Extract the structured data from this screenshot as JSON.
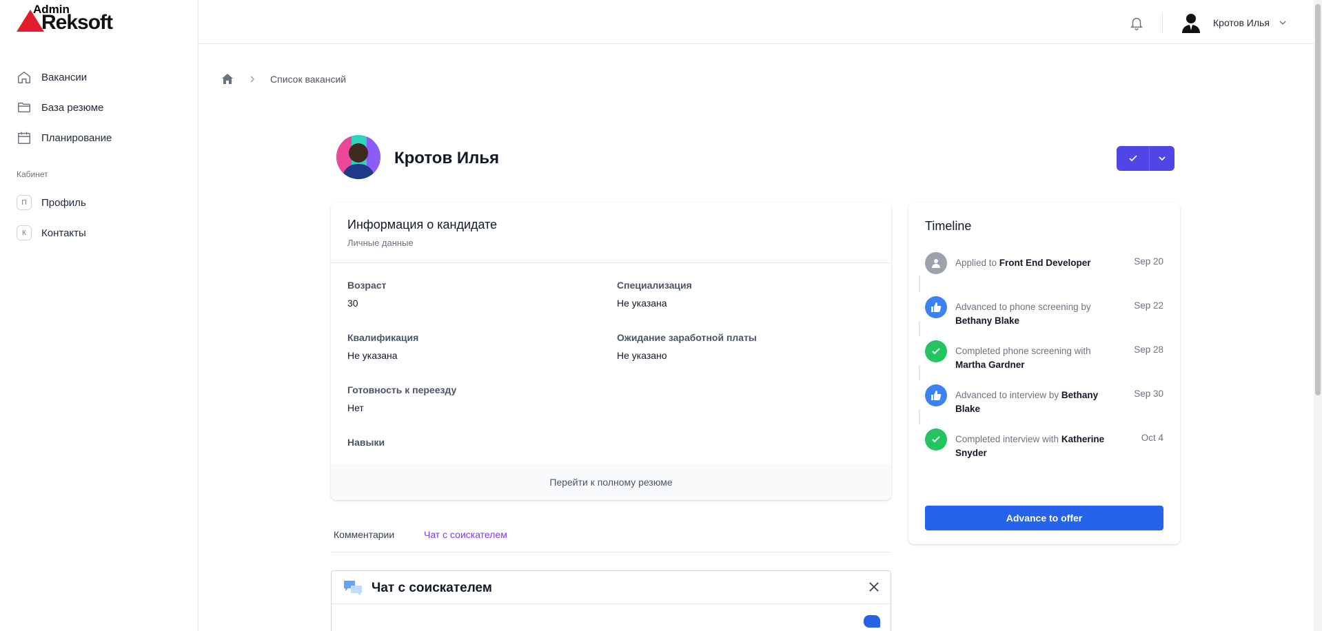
{
  "app": {
    "logo_top": "Admin",
    "logo_main": "Reksoft",
    "brand_color": "#e11d2e",
    "accent_color": "#4f46e5",
    "primary_color": "#2563eb"
  },
  "sidebar": {
    "items": [
      {
        "label": "Вакансии",
        "icon": "home-icon"
      },
      {
        "label": "База резюме",
        "icon": "folder-icon"
      },
      {
        "label": "Планирование",
        "icon": "calendar-icon"
      }
    ],
    "section_label": "Кабинет",
    "cabinet_items": [
      {
        "letter": "П",
        "label": "Профиль"
      },
      {
        "letter": "К",
        "label": "Контакты"
      }
    ]
  },
  "header": {
    "user_name": "Кротов Илья"
  },
  "breadcrumb": {
    "current": "Список вакансий"
  },
  "candidate": {
    "name": "Кротов Илья"
  },
  "info_card": {
    "title": "Информация о кандидате",
    "subtitle": "Личные данные",
    "fields": [
      {
        "label": "Возраст",
        "value": "30"
      },
      {
        "label": "Специализация",
        "value": "Не указана"
      },
      {
        "label": "Квалификация",
        "value": "Не указана"
      },
      {
        "label": "Ожидание заработной платы",
        "value": "Не указано"
      },
      {
        "label": "Готовность к переезду",
        "value": "Нет"
      },
      {
        "label": "Навыки",
        "value": ""
      }
    ],
    "footer_link": "Перейти к полному резюме"
  },
  "tabs": [
    {
      "label": "Комментарии",
      "active": false
    },
    {
      "label": "Чат с соискателем",
      "active": true
    }
  ],
  "chat": {
    "title": "Чат с соискателем"
  },
  "timeline": {
    "title": "Timeline",
    "items": [
      {
        "type": "user",
        "prefix": "Applied to ",
        "strong": "Front End Developer",
        "suffix": "",
        "date": "Sep 20"
      },
      {
        "type": "thumb",
        "prefix": "Advanced to phone screening by ",
        "strong": "Bethany Blake",
        "suffix": "",
        "date": "Sep 22"
      },
      {
        "type": "check",
        "prefix": "Completed phone screening with ",
        "strong": "Martha Gardner",
        "suffix": "",
        "date": "Sep 28"
      },
      {
        "type": "thumb",
        "prefix": "Advanced to interview by ",
        "strong": "Bethany Blake",
        "suffix": "",
        "date": "Sep 30"
      },
      {
        "type": "check",
        "prefix": "Completed interview with ",
        "strong": "Katherine Snyder",
        "suffix": "",
        "date": "Oct 4"
      }
    ],
    "button": "Advance to offer"
  }
}
